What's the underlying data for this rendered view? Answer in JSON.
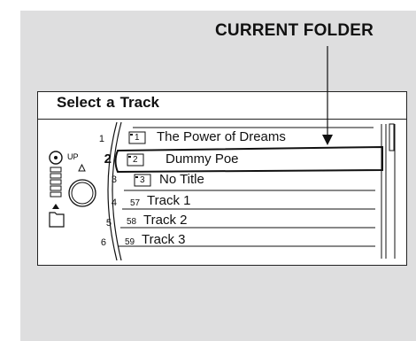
{
  "callout": {
    "label": "CURRENT FOLDER"
  },
  "screen": {
    "title_word1": "Select",
    "title_word2": "a",
    "title_word3": "Track",
    "up_label": "UP",
    "current_index": "2"
  },
  "rows": [
    {
      "num": "1",
      "tag": "1",
      "label": "The Power of Dreams"
    },
    {
      "num": "2",
      "tag": "2",
      "label": "Dummy Poe"
    },
    {
      "num": "3",
      "tag": "3",
      "label": "No Title"
    },
    {
      "num": "4",
      "tag": "57",
      "label": "Track 1"
    },
    {
      "num": "5",
      "tag": "58",
      "label": "Track 2"
    },
    {
      "num": "6",
      "tag": "59",
      "label": "Track 3"
    }
  ]
}
